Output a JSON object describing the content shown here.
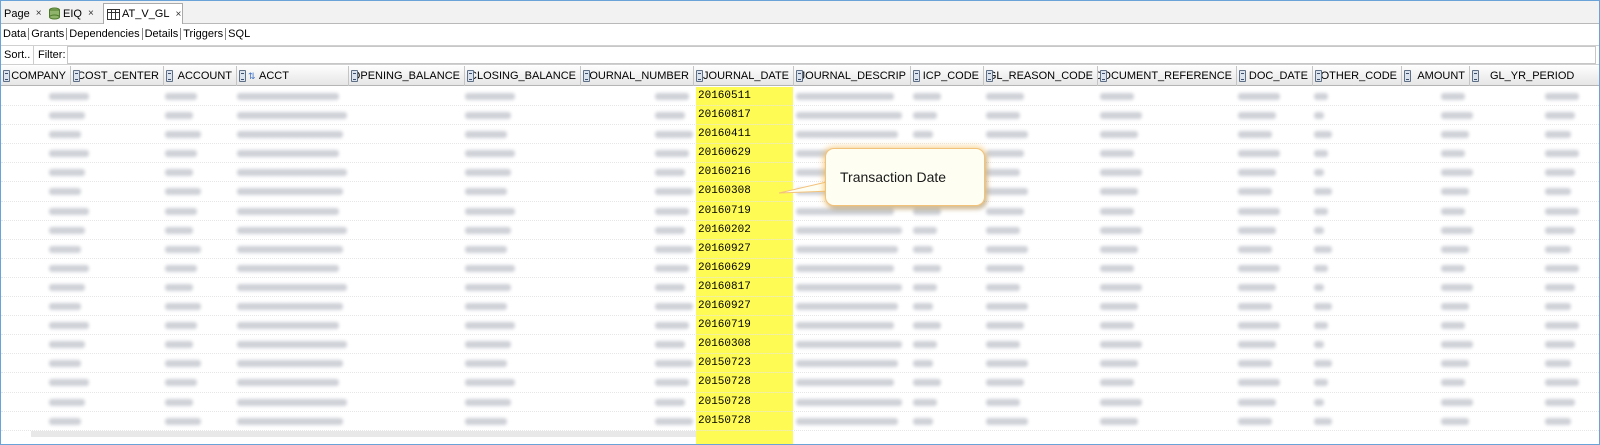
{
  "tabs": [
    {
      "label": "Page",
      "active": false
    },
    {
      "label": "EIQ",
      "active": false,
      "icon": "database-icon"
    },
    {
      "label": "AT_V_GL",
      "active": true,
      "icon": "table-icon"
    }
  ],
  "subtabs": [
    "Data",
    "Grants",
    "Dependencies",
    "Details",
    "Triggers",
    "SQL"
  ],
  "filterbar": {
    "sort_label": "Sort..",
    "filter_label": "Filter:",
    "filter_value": ""
  },
  "columns": [
    "COMPANY",
    "COST_CENTER",
    "ACCOUNT",
    "ACCT",
    "OPENING_BALANCE",
    "CLOSING_BALANCE",
    "JOURNAL_NUMBER",
    "JOURNAL_DATE",
    "JOURNAL_DESCRIP",
    "ICP_CODE",
    "GL_REASON_CODE",
    "DOCUMENT_REFERENCE",
    "DOC_DATE",
    "OTHER_CODE",
    "AMOUNT",
    "GL_YR_PERIOD"
  ],
  "journal_dates": [
    "20160511",
    "20160817",
    "20160411",
    "20160629",
    "20160216",
    "20160308",
    "20160719",
    "20160202",
    "20160927",
    "20160629",
    "20160817",
    "20160927",
    "20160719",
    "20160308",
    "20150723",
    "20150728",
    "20150728",
    "20150728"
  ],
  "callout": {
    "text": "Transaction Date"
  },
  "colors": {
    "highlight": "#fffb55",
    "callout_border": "#f3c27a",
    "frame": "#6aa3d8"
  }
}
